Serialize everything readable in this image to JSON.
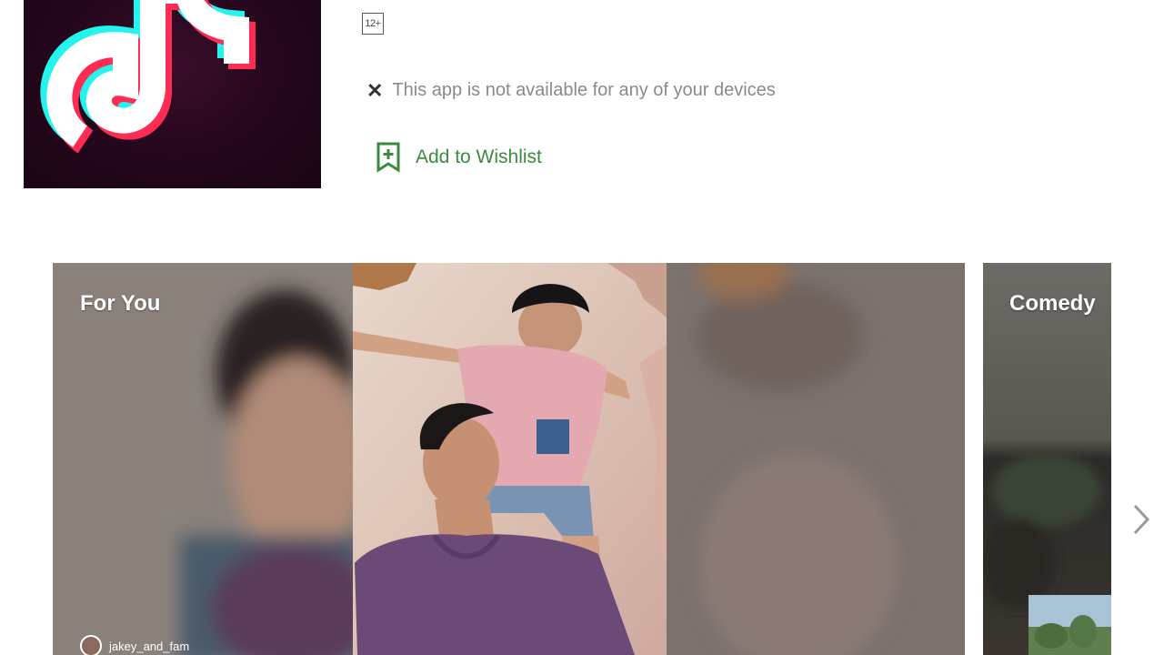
{
  "app": {
    "rating_badge": "12+",
    "availability": "This app is not available for any of your devices",
    "wishlist_label": "Add to Wishlist"
  },
  "screenshots": [
    {
      "title": "For You",
      "username": "jakey_and_fam"
    },
    {
      "title": "Comedy"
    }
  ],
  "icons": {
    "close": "close-icon",
    "wishlist": "bookmark-add-icon",
    "next": "chevron-right-icon"
  },
  "colors": {
    "accent_green": "#3b8a3e",
    "tiktok_cyan": "#25f4ee",
    "tiktok_red": "#fe2c55"
  }
}
